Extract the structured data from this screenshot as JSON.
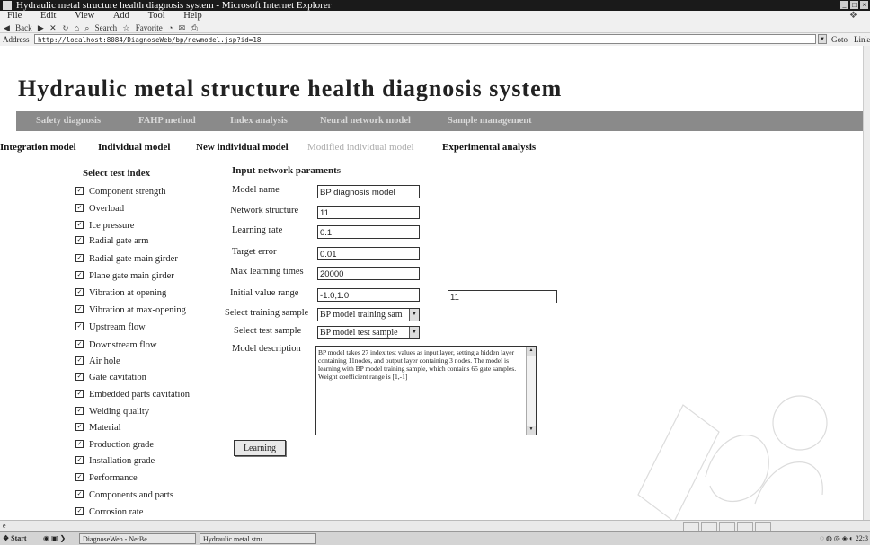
{
  "window": {
    "title": "Hydraulic metal structure health diagnosis system - Microsoft Internet Explorer",
    "controls": [
      "_",
      "□",
      "×"
    ]
  },
  "menu": [
    "File",
    "Edit",
    "View",
    "Add",
    "Tool",
    "Help"
  ],
  "toolbar": {
    "back": "Back",
    "search": "Search",
    "favorites": "Favorite"
  },
  "address": {
    "label": "Address",
    "url": "http://localhost:8084/DiagnoseWeb/bp/newmodel.jsp?id=18",
    "go": "Goto",
    "links": "Links"
  },
  "page": {
    "title": "Hydraulic metal structure health diagnosis system",
    "nav": [
      "Safety diagnosis",
      "FAHP method",
      "Index analysis",
      "Neural network model",
      "Sample management"
    ],
    "subtabs": [
      {
        "label": "Integration model",
        "active": true
      },
      {
        "label": "Individual model",
        "active": true
      },
      {
        "label": "New individual model",
        "active": true
      },
      {
        "label": "Modified individual model",
        "active": false
      },
      {
        "label": "Experimental analysis",
        "active": true
      }
    ],
    "index_heading": "Select test index",
    "indices": [
      "Component strength",
      "Overload",
      "Ice pressure",
      "Radial gate arm",
      "Radial gate main girder",
      "Plane gate main girder",
      "Vibration at opening",
      "Vibration at max-opening",
      "Upstream flow",
      "Downstream flow",
      "Air hole",
      "Gate cavitation",
      "Embedded parts cavitation",
      "Welding quality",
      "Material",
      "Production grade",
      "Installation grade",
      "Performance",
      "Components and parts",
      "Corrosion rate"
    ],
    "params_heading": "Input network paraments",
    "fields": {
      "model_name": {
        "label": "Model name",
        "value": "BP diagnosis model"
      },
      "network_structure": {
        "label": "Network structure",
        "value": "11"
      },
      "learning_rate": {
        "label": "Learning rate",
        "value": "0.1"
      },
      "target_error": {
        "label": "Target error",
        "value": "0.01"
      },
      "max_learning_times": {
        "label": "Max learning times",
        "value": "20000"
      },
      "initial_value_range": {
        "label": "Initial value range",
        "value": "-1.0,1.0",
        "extra": "11"
      },
      "training_sample": {
        "label": "Select training sample",
        "value": "BP model training sam"
      },
      "test_sample": {
        "label": "Select test sample",
        "value": "BP model test sample"
      },
      "model_description": {
        "label": "Model description",
        "value": "BP model takes 27 index test values as input layer, setting a hidden layer containing 11nodes, and output layer containing 3 nodes. The model is learning with BP model training sample, which contains 65 gate samples. Weight coefficient range is [1,-1]"
      }
    },
    "learning_button": "Learning"
  },
  "status": {
    "icon": "e"
  },
  "taskbar": {
    "start": "Start",
    "tasks": [
      "DiagnoseWeb - NetBe...",
      "Hydraulic metal stru..."
    ],
    "clock": "22:3"
  }
}
